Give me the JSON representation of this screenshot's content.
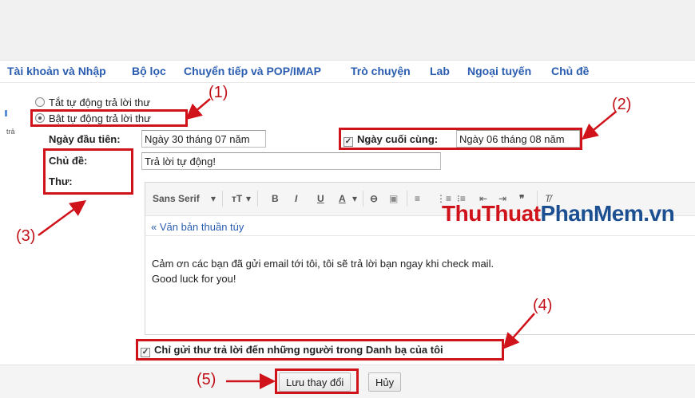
{
  "settings_tabs": [
    {
      "label": "Tài khoản và Nhập"
    },
    {
      "label": "Bộ lọc"
    },
    {
      "label": "Chuyển tiếp và POP/IMAP"
    },
    {
      "label": "Trò chuyện"
    },
    {
      "label": "Lab"
    },
    {
      "label": "Ngoại tuyến"
    },
    {
      "label": "Chủ đề"
    }
  ],
  "sidebar_stub": "trả",
  "vacation": {
    "off_label": "Tắt tự động trả lời thư",
    "on_label": "Bật tự động trả lời thư",
    "selected": "on",
    "first_day_label": "Ngày đầu tiên:",
    "first_day_value": "Ngày 30 tháng 07 năm",
    "last_day_label": "Ngày cuối cùng:",
    "last_day_value": "Ngày 06 tháng 08 năm",
    "last_day_checked": true,
    "subject_label": "Chủ đề:",
    "subject_value": "Trả lời tự động!",
    "message_label": "Thư:",
    "plain_text_link": "« Văn bản thuần túy",
    "message_lines": [
      "Cảm ơn các bạn đã gửi email tới tôi, tôi sẽ trả lời bạn ngay khi check mail.",
      "Good luck for you!"
    ],
    "contacts_only_label": "Chỉ gửi thư trả lời đến những người trong Danh bạ của tôi",
    "contacts_only_checked": true
  },
  "toolbar": {
    "font": "Sans Serif",
    "dropdown": "▾",
    "size": "тT",
    "bold": "B",
    "italic": "I",
    "underline": "U",
    "text_color": "A",
    "link": "⊖",
    "image": "▣",
    "align": "≡",
    "numbered": "⋮≡",
    "bullets": "⁝≡",
    "indent_less": "⇤",
    "indent_more": "⇥",
    "quote": "❞",
    "clear": "T̸"
  },
  "buttons": {
    "save": "Lưu thay đổi",
    "cancel": "Hủy"
  },
  "annotations": {
    "a1": "(1)",
    "a2": "(2)",
    "a3": "(3)",
    "a4": "(4)",
    "a5": "(5)"
  },
  "watermark": {
    "part1": "ThuThuat",
    "part2": "PhanMem",
    "part3": ".vn"
  },
  "colors": {
    "link_blue": "#2a5db0",
    "annotation_red": "#d0131b"
  }
}
